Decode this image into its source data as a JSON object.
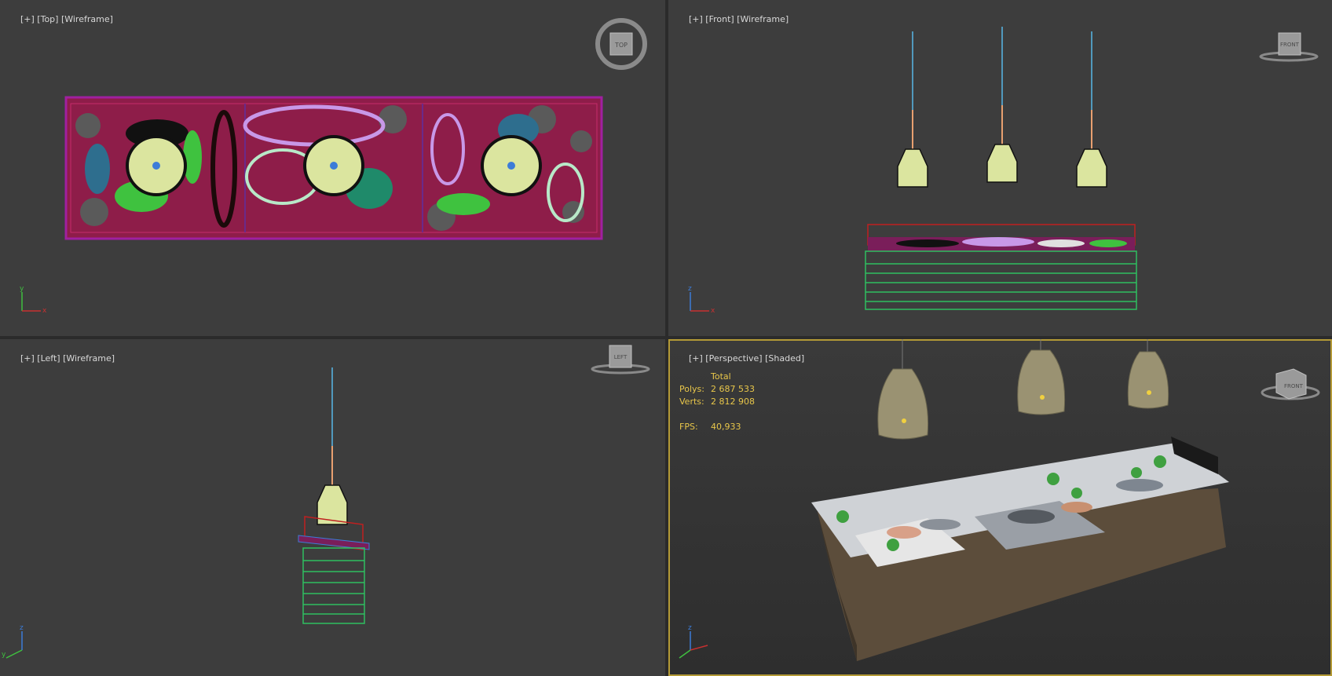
{
  "viewports": {
    "top": {
      "labels": [
        "[+]",
        "[Top]",
        "[Wireframe]"
      ],
      "cube": "TOP"
    },
    "front": {
      "labels": [
        "[+]",
        "[Front]",
        "[Wireframe]"
      ],
      "cube": "FRONT"
    },
    "left": {
      "labels": [
        "[+]",
        "[Left]",
        "[Wireframe]"
      ],
      "cube": "LEFT"
    },
    "perspective": {
      "labels": [
        "[+]",
        "[Perspective]",
        "[Shaded]"
      ],
      "cube": "FRONT",
      "stats": {
        "header": "Total",
        "polys_label": "Polys:",
        "polys": "2 687 533",
        "verts_label": "Verts:",
        "verts": "2 812 908",
        "fps_label": "FPS:",
        "fps": "40,933"
      }
    }
  },
  "axes": {
    "x": "x",
    "y": "y",
    "z": "z"
  },
  "colors": {
    "viewport_bg": "#3d3d3d",
    "active_border": "#b49a36",
    "stats_text": "#e8c64a"
  }
}
